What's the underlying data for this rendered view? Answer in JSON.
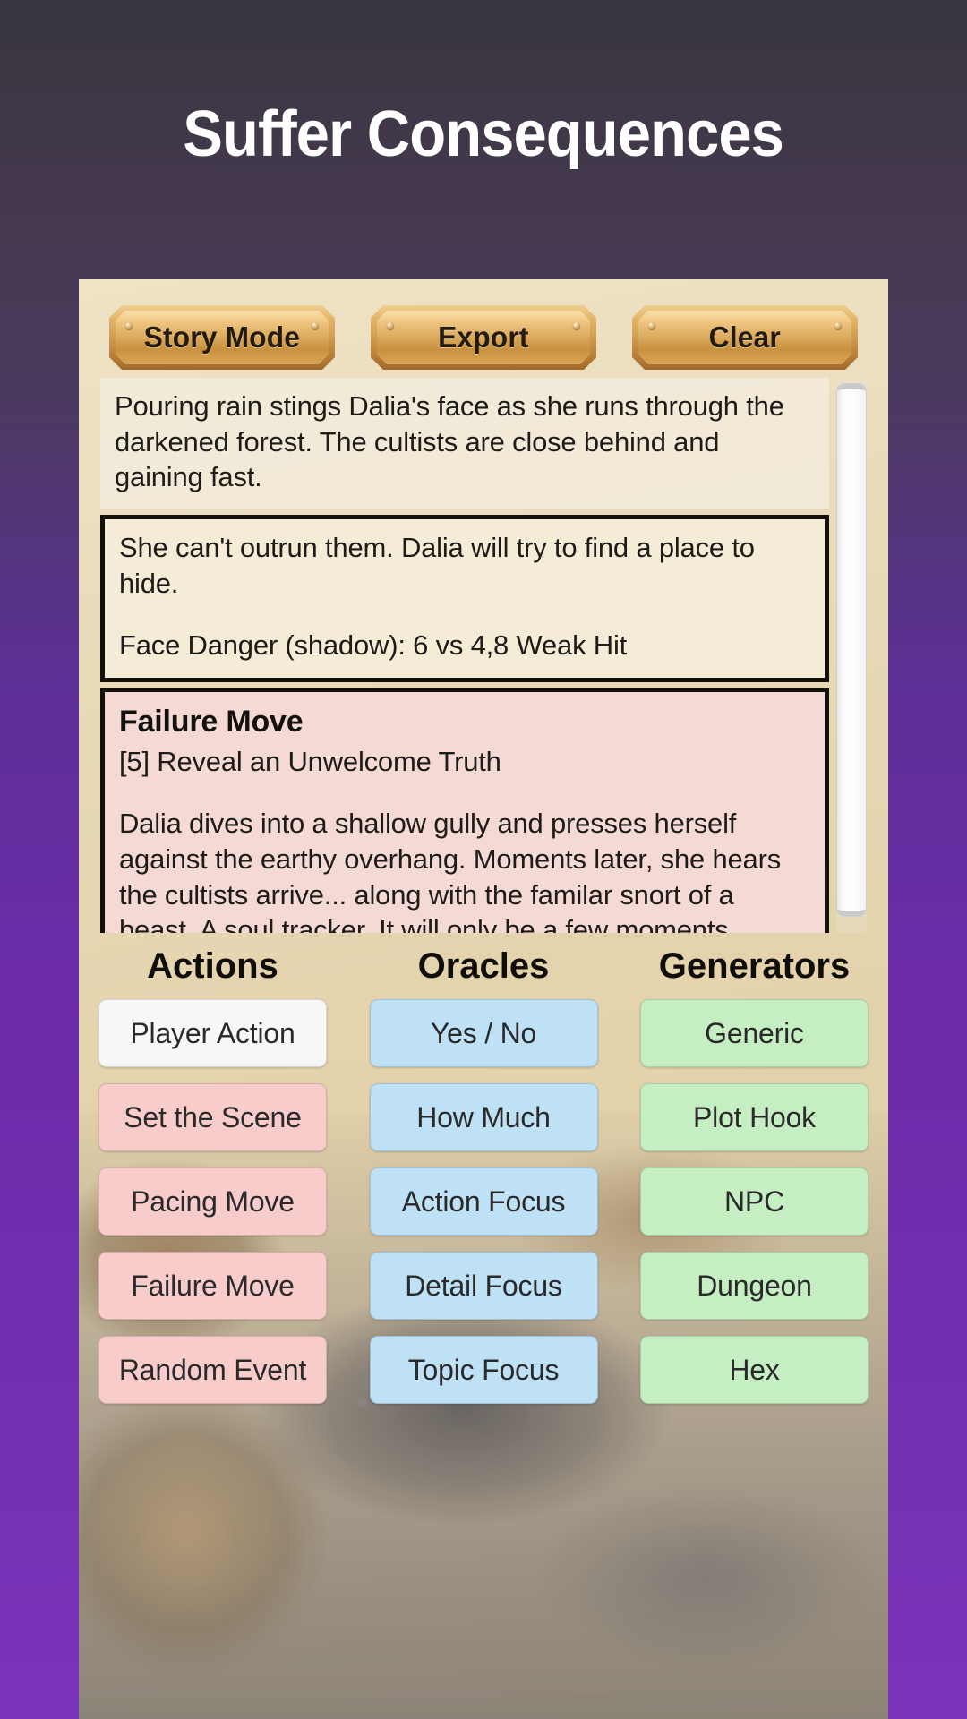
{
  "header": {
    "title": "Suffer Consequences"
  },
  "toolbar": {
    "buttons": [
      {
        "label": "Story Mode",
        "name": "story-mode-button"
      },
      {
        "label": "Export",
        "name": "export-button"
      },
      {
        "label": "Clear",
        "name": "clear-button"
      }
    ]
  },
  "log": {
    "narration": "Pouring rain stings Dalia's face as she runs through the darkened forest.  The cultists are close behind and gaining fast.",
    "action": {
      "text": "She can't outrun them.  Dalia will try to find a place to hide.",
      "roll": "Face Danger (shadow): 6 vs 4,8 Weak Hit"
    },
    "move": {
      "title": "Failure Move",
      "subtitle": "[5] Reveal an Unwelcome Truth",
      "text": "Dalia dives into a shallow gully and presses herself against the earthy overhang.  Moments later, she hears the cultists arrive... along with the familar snort of a beast.  A soul tracker.  It will only be a few moments before it's onto her scent.  What do you do?"
    }
  },
  "grid": {
    "columns": [
      {
        "header": "Actions",
        "color": "#f8ccca"
      },
      {
        "header": "Oracles",
        "color": "#bee1f5"
      },
      {
        "header": "Generators",
        "color": "#c6eec3"
      }
    ],
    "rows": [
      [
        {
          "label": "Player Action",
          "style": "white"
        },
        {
          "label": "Yes / No",
          "style": "blue"
        },
        {
          "label": "Generic",
          "style": "green"
        }
      ],
      [
        {
          "label": "Set the Scene",
          "style": "pink"
        },
        {
          "label": "How Much",
          "style": "blue"
        },
        {
          "label": "Plot Hook",
          "style": "green"
        }
      ],
      [
        {
          "label": "Pacing Move",
          "style": "pink"
        },
        {
          "label": "Action Focus",
          "style": "blue"
        },
        {
          "label": "NPC",
          "style": "green"
        }
      ],
      [
        {
          "label": "Failure Move",
          "style": "pink"
        },
        {
          "label": "Detail Focus",
          "style": "blue"
        },
        {
          "label": "Dungeon",
          "style": "green"
        }
      ],
      [
        {
          "label": "Random Event",
          "style": "pink"
        },
        {
          "label": "Topic Focus",
          "style": "blue"
        },
        {
          "label": "Hex",
          "style": "green"
        }
      ]
    ]
  },
  "colors": {
    "accent_purple": "#6b2ba8",
    "header_bg": "#3a3640",
    "brass": "#cf9a4d",
    "pink": "#f8ccca",
    "blue": "#bee1f5",
    "green": "#c6eec3"
  }
}
